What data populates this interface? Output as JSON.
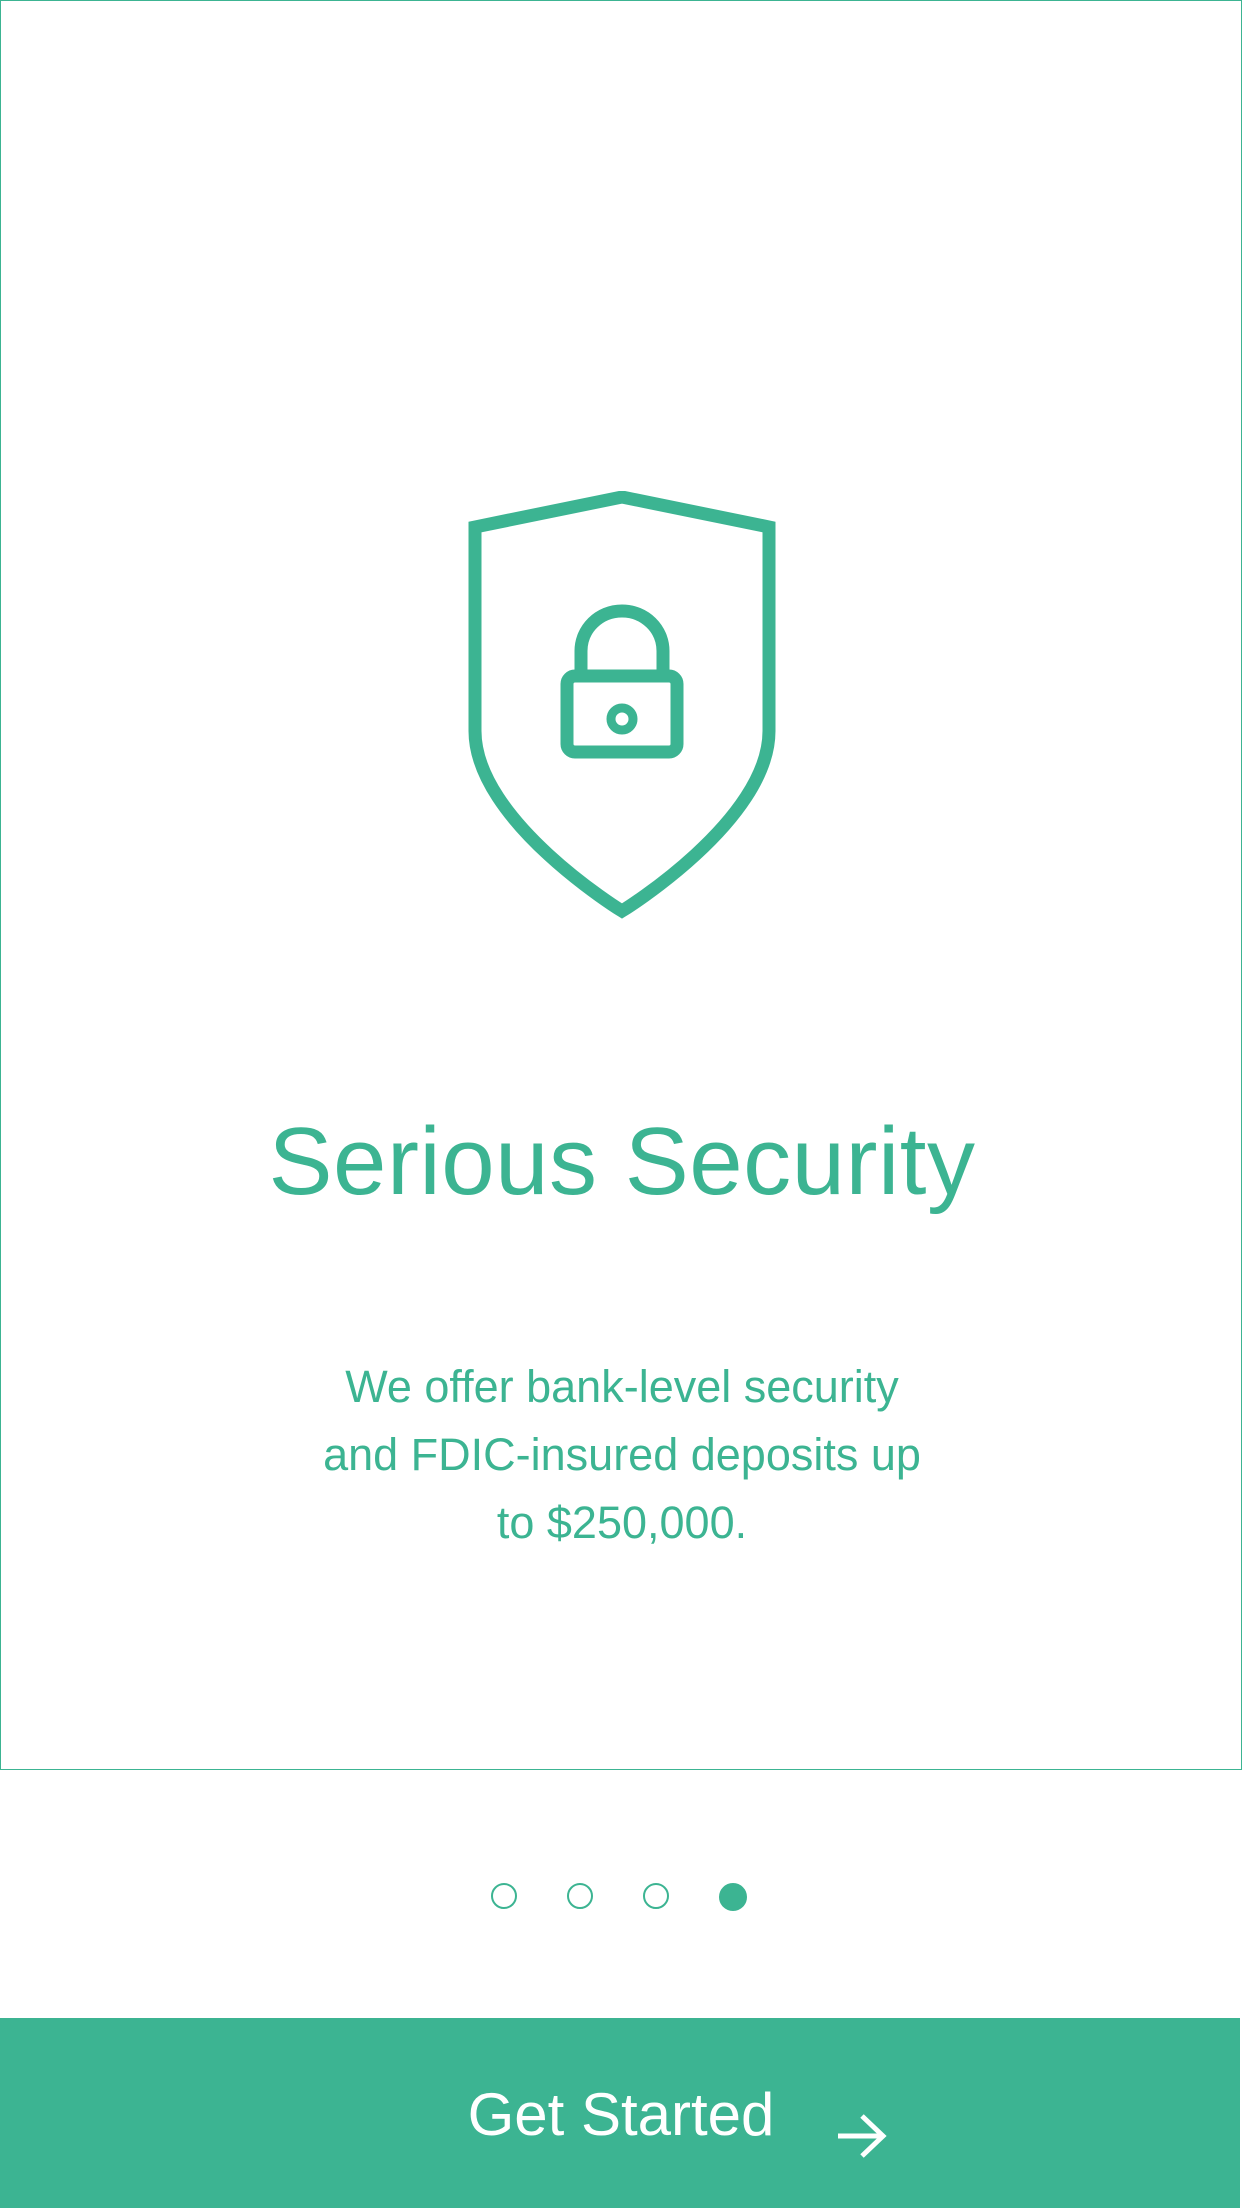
{
  "onboarding": {
    "title": "Serious Security",
    "description": "We offer bank-level security and FDIC-insured deposits up to $250,000."
  },
  "pager": {
    "total_pages": 4,
    "current_page": 4
  },
  "cta": {
    "label": "Get Started"
  },
  "icons": {
    "hero": "shield-lock-icon",
    "cta": "arrow-right-icon"
  },
  "colors": {
    "accent": "#3cb492",
    "background": "#ffffff",
    "cta_text": "#ffffff"
  }
}
